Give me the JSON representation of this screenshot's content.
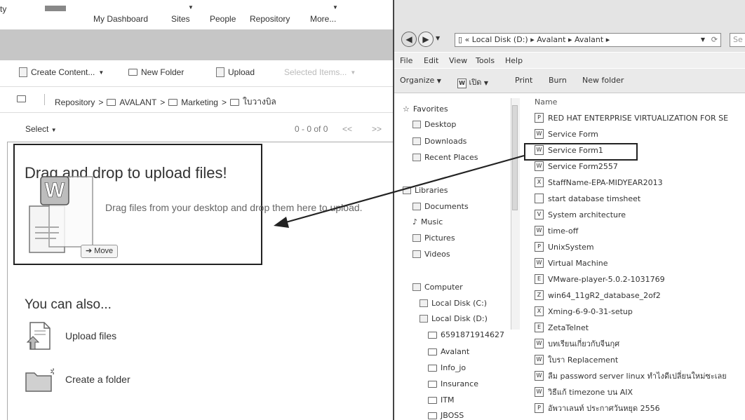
{
  "alfresco": {
    "nav": {
      "brand_partial": "ty",
      "items": [
        "My Dashboard",
        "Sites",
        "People",
        "Repository",
        "More..."
      ]
    },
    "toolbar": {
      "create_content": "Create Content...",
      "new_folder": "New Folder",
      "upload": "Upload",
      "selected_items": "Selected Items..."
    },
    "breadcrumb": [
      "Repository",
      "AVALANT",
      "Marketing",
      "ใบวางบิล"
    ],
    "select_label": "Select",
    "pagination": {
      "range": "0 - 0 of 0",
      "prev": "<<",
      "next": ">>"
    },
    "dropzone": {
      "title": "Drag and drop to upload files!",
      "subtitle": "Drag files from your desktop and drop them here to upload.",
      "move_label": "Move"
    },
    "also": {
      "title": "You can also...",
      "upload_files": "Upload files",
      "create_folder": "Create a folder"
    }
  },
  "explorer": {
    "address": [
      "«",
      "Local Disk (D:)",
      "Avalant",
      "Avalant"
    ],
    "search_placeholder": "Se",
    "menu": [
      "File",
      "Edit",
      "View",
      "Tools",
      "Help"
    ],
    "commands": {
      "organize": "Organize",
      "open_with": "เปิด",
      "print": "Print",
      "burn": "Burn",
      "new_folder": "New folder"
    },
    "nav_pane": [
      {
        "label": "Favorites",
        "icon": "star-icon"
      },
      {
        "label": "Desktop",
        "icon": "desktop-icon"
      },
      {
        "label": "Downloads",
        "icon": "downloads-icon"
      },
      {
        "label": "Recent Places",
        "icon": "recent-places-icon"
      },
      {
        "label": "Libraries",
        "icon": "libraries-icon"
      },
      {
        "label": "Documents",
        "icon": "documents-icon"
      },
      {
        "label": "Music",
        "icon": "music-icon"
      },
      {
        "label": "Pictures",
        "icon": "pictures-icon"
      },
      {
        "label": "Videos",
        "icon": "videos-icon"
      },
      {
        "label": "Computer",
        "icon": "computer-icon"
      },
      {
        "label": "Local Disk (C:)",
        "icon": "drive-icon"
      },
      {
        "label": "Local Disk (D:)",
        "icon": "drive-icon"
      },
      {
        "label": "6591871914627",
        "icon": "folder-icon"
      },
      {
        "label": "Avalant",
        "icon": "folder-icon"
      },
      {
        "label": "Info_jo",
        "icon": "folder-icon"
      },
      {
        "label": "Insurance",
        "icon": "folder-icon"
      },
      {
        "label": "ITM",
        "icon": "folder-icon"
      },
      {
        "label": "JBOSS",
        "icon": "folder-icon"
      }
    ],
    "column_name": "Name",
    "files": [
      {
        "name": "RED HAT ENTERPRISE VIRTUALIZATION FOR SE",
        "type": "P"
      },
      {
        "name": "Service Form",
        "type": "W"
      },
      {
        "name": "Service Form1",
        "type": "W",
        "selected": true
      },
      {
        "name": "Service Form2557",
        "type": "W"
      },
      {
        "name": "StaffName-EPA-MIDYEAR2013",
        "type": "X"
      },
      {
        "name": "start database timsheet",
        "type": ""
      },
      {
        "name": "System architecture",
        "type": "V"
      },
      {
        "name": "time-off",
        "type": "W"
      },
      {
        "name": "UnixSystem",
        "type": "P"
      },
      {
        "name": "Virtual Machine",
        "type": "W"
      },
      {
        "name": "VMware-player-5.0.2-1031769",
        "type": "E"
      },
      {
        "name": "win64_11gR2_database_2of2",
        "type": "Z"
      },
      {
        "name": "Xming-6-9-0-31-setup",
        "type": "X"
      },
      {
        "name": "ZetaTelnet",
        "type": "E"
      },
      {
        "name": "บทเรียนเกี่ยวกับจีนกุศ",
        "type": "W"
      },
      {
        "name": "ใบรา Replacement",
        "type": "W"
      },
      {
        "name": "ลืม password server linux ทำไงดีเปลี่ยนใหม่ซะเลย",
        "type": "W"
      },
      {
        "name": "วิธีแก้ timezone บน AIX",
        "type": "W"
      },
      {
        "name": "อัพวาเลนท์ ประกาศวันหยุด 2556",
        "type": "P"
      }
    ]
  }
}
